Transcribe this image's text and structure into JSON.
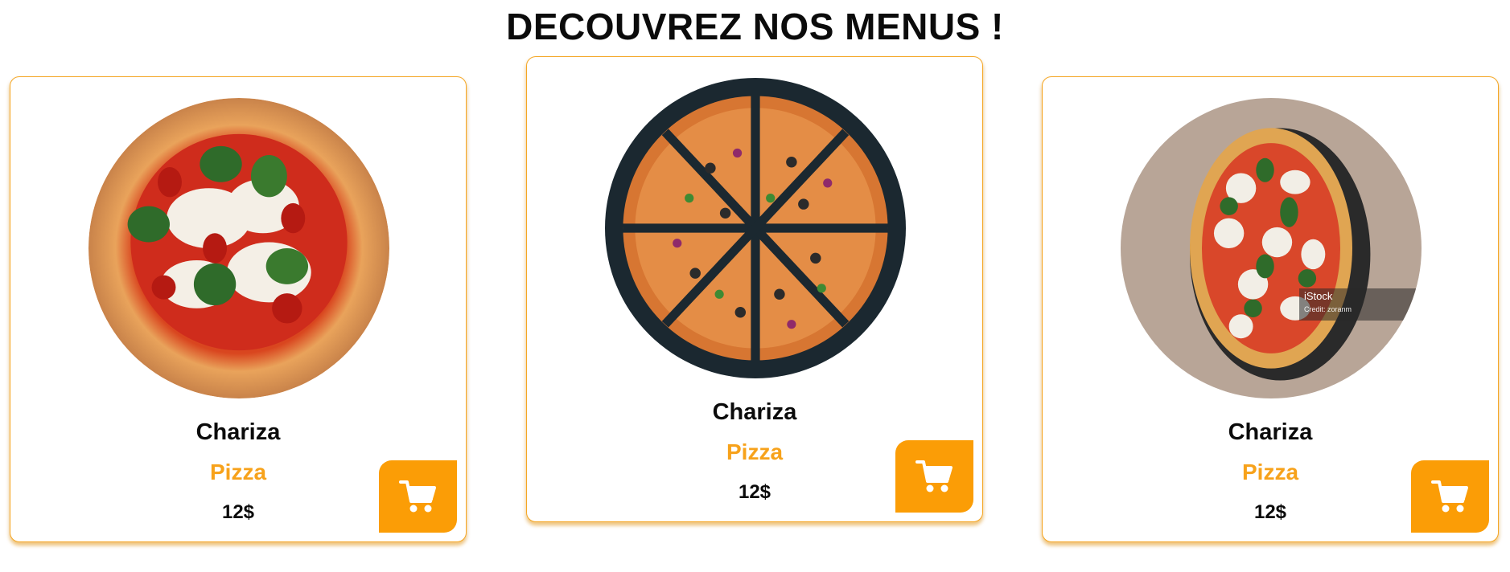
{
  "title": "DECOUVREZ NOS MENUS !",
  "colors": {
    "accent": "#fb9d06",
    "category_text": "#f7a21b",
    "border": "#f5a623"
  },
  "cards": [
    {
      "name": "Chariza",
      "category": "Pizza",
      "price": "12$",
      "image": "margherita-pizza-with-basil",
      "cart_icon": "shopping-cart-icon"
    },
    {
      "name": "Chariza",
      "category": "Pizza",
      "price": "12$",
      "image": "sliced-pizza-on-dark-background",
      "cart_icon": "shopping-cart-icon"
    },
    {
      "name": "Chariza",
      "category": "Pizza",
      "price": "12$",
      "image": "margherita-pizza-on-stone",
      "cart_icon": "shopping-cart-icon",
      "watermark": {
        "brand": "iStock",
        "credit": "Credit: zoranm"
      }
    }
  ]
}
